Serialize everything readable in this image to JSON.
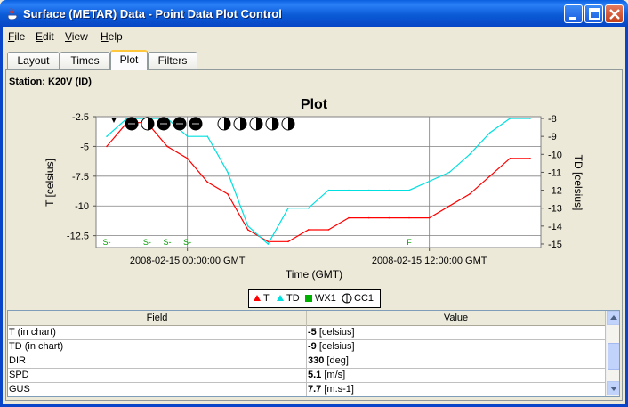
{
  "window": {
    "title": "Surface (METAR) Data - Point Data Plot Control"
  },
  "menu": [
    {
      "label": "File",
      "mnemonic": "F",
      "rest": "ile"
    },
    {
      "label": "Edit",
      "mnemonic": "E",
      "rest": "dit"
    },
    {
      "label": "View",
      "mnemonic": "V",
      "rest": "iew"
    },
    {
      "label": "Help",
      "mnemonic": "H",
      "rest": "elp"
    }
  ],
  "tabs": [
    {
      "label": "Layout",
      "active": false
    },
    {
      "label": "Times",
      "active": false
    },
    {
      "label": "Plot",
      "active": true
    },
    {
      "label": "Filters",
      "active": false
    }
  ],
  "station_label": "Station: K20V (ID)",
  "chart_data": {
    "type": "line",
    "title": "Plot",
    "xlabel": "Time (GMT)",
    "ylabel_left": "T [celsius]",
    "ylabel_right": "TD [celsius]",
    "x_ticks": [
      "2008-02-15 00:00:00 GMT",
      "2008-02-15 12:00:00 GMT"
    ],
    "x": [
      "2008-02-14 20:00",
      "2008-02-14 21:00",
      "2008-02-14 22:00",
      "2008-02-14 23:00",
      "2008-02-15 00:00",
      "2008-02-15 01:00",
      "2008-02-15 02:00",
      "2008-02-15 03:00",
      "2008-02-15 04:00",
      "2008-02-15 05:00",
      "2008-02-15 06:00",
      "2008-02-15 07:00",
      "2008-02-15 08:00",
      "2008-02-15 09:00",
      "2008-02-15 10:00",
      "2008-02-15 11:00",
      "2008-02-15 12:00",
      "2008-02-15 13:00",
      "2008-02-15 14:00",
      "2008-02-15 15:00",
      "2008-02-15 16:00",
      "2008-02-15 17:00"
    ],
    "left_axis": {
      "ticks": [
        "-2.5",
        "-5",
        "-7.5",
        "-10",
        "-12.5"
      ],
      "range": [
        -13.5,
        -2.5
      ]
    },
    "right_axis": {
      "ticks": [
        "-8",
        "-9",
        "-10",
        "-11",
        "-12",
        "-13",
        "-14",
        "-15"
      ],
      "range": [
        -15.2,
        -7.9
      ]
    },
    "series": [
      {
        "name": "T",
        "color": "#ff0000",
        "values": [
          -5,
          -3,
          -3,
          -5,
          -6,
          -8,
          -9,
          -12,
          -13,
          -13,
          -12,
          -12,
          -11,
          -11,
          -11,
          -11,
          -11,
          -10,
          -9,
          -7.5,
          -6,
          -6
        ]
      },
      {
        "name": "TD",
        "color": "#00e0e0",
        "values": [
          -9,
          -8,
          -8,
          -8,
          -9,
          -9,
          -11,
          -14,
          -15,
          -13,
          -13,
          -12,
          -12,
          -12,
          -12,
          -12,
          -11.5,
          -11,
          -10,
          -8.8,
          -8,
          -8
        ]
      }
    ],
    "weather_markers": [
      {
        "label": "S-",
        "x_index": 0
      },
      {
        "label": "S-",
        "x_index": 2
      },
      {
        "label": "S-",
        "x_index": 3
      },
      {
        "label": "S-",
        "x_index": 4
      },
      {
        "label": "F",
        "x_index": 15
      }
    ],
    "cloud_markers": [
      "full",
      "half",
      "full",
      "full",
      "full",
      "half",
      "half",
      "half",
      "half",
      "half"
    ],
    "grid": true
  },
  "legend": [
    {
      "label": "T",
      "color": "#ff0000",
      "icon": "point-marker-icon"
    },
    {
      "label": "TD",
      "color": "#00e0e0",
      "icon": "point-marker-icon"
    },
    {
      "label": "WX1",
      "color": "#00b000",
      "icon": "square-icon"
    },
    {
      "label": "CC1",
      "color": "#000000",
      "icon": "cloud-cover-icon"
    }
  ],
  "table": {
    "headers": [
      "Field",
      "Value"
    ],
    "rows": [
      {
        "field": "T (in chart)",
        "value": "-5",
        "unit": "[celsius]"
      },
      {
        "field": "TD (in chart)",
        "value": "-9",
        "unit": "[celsius]"
      },
      {
        "field": "DIR",
        "value": "330",
        "unit": "[deg]"
      },
      {
        "field": "SPD",
        "value": "5.1",
        "unit": "[m/s]"
      },
      {
        "field": "GUS",
        "value": "7.7",
        "unit": "[m.s-1]"
      }
    ]
  }
}
